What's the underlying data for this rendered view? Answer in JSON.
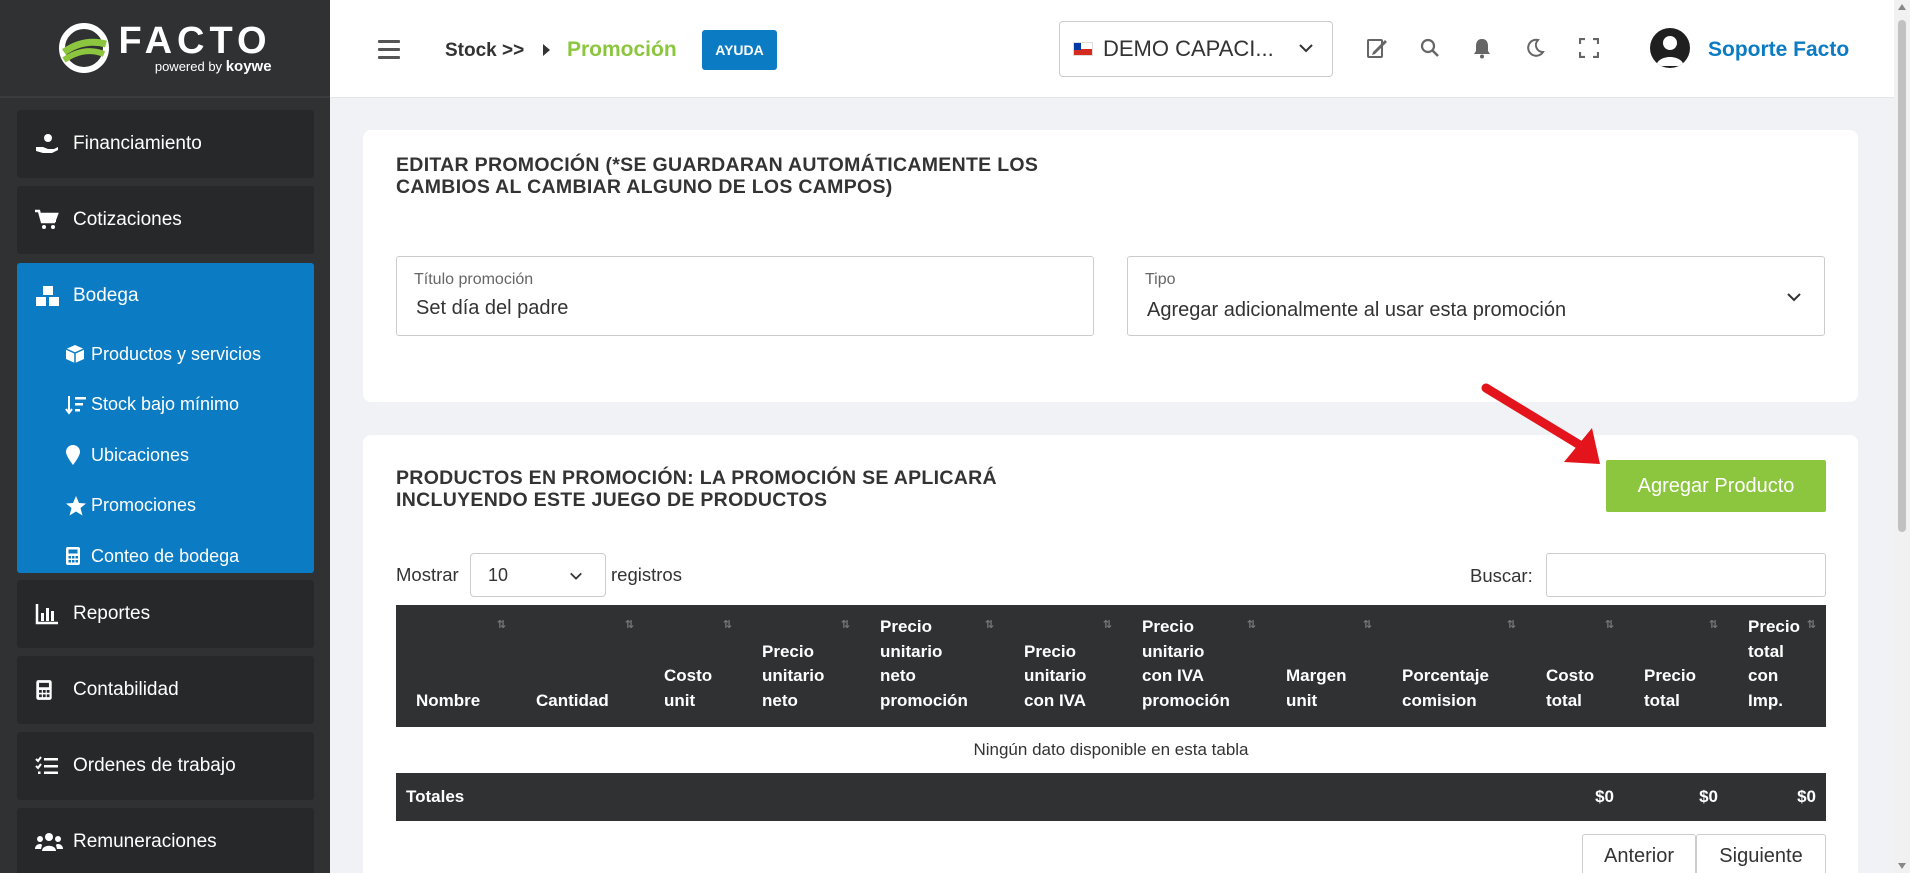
{
  "brand": {
    "name": "FACTO",
    "powered": "powered by",
    "partner": "koywe"
  },
  "sidebar": {
    "items_top": [
      {
        "label": "Financiamiento",
        "icon": "hand-money-icon"
      },
      {
        "label": "Cotizaciones",
        "icon": "cart-icon"
      }
    ],
    "group": {
      "label": "Bodega",
      "icon": "boxes-icon",
      "items": [
        {
          "label": "Productos y servicios",
          "icon": "box-icon"
        },
        {
          "label": "Stock bajo mínimo",
          "icon": "sort-down-icon"
        },
        {
          "label": "Ubicaciones",
          "icon": "map-pin-icon"
        },
        {
          "label": "Promociones",
          "icon": "star-icon"
        },
        {
          "label": "Conteo de bodega",
          "icon": "calculator-icon"
        }
      ]
    },
    "items_bottom": [
      {
        "label": "Reportes",
        "icon": "chart-icon"
      },
      {
        "label": "Contabilidad",
        "icon": "calculator-icon"
      },
      {
        "label": "Ordenes de trabajo",
        "icon": "task-list-icon"
      },
      {
        "label": "Remuneraciones",
        "icon": "users-icon"
      }
    ]
  },
  "header": {
    "breadcrumb_parent": "Stock >>",
    "breadcrumb_current": "Promoción",
    "help_label": "AYUDA",
    "company": "DEMO CAPACI...",
    "user_name": "Soporte Facto"
  },
  "edit_card": {
    "title": "EDITAR PROMOCIÓN (*SE GUARDARAN AUTOMÁTICAMENTE LOS CAMBIOS AL CAMBIAR ALGUNO DE LOS CAMPOS)",
    "title_line1": "EDITAR PROMOCIÓN (*SE GUARDARAN AUTOMÁTICAMENTE LOS",
    "title_line2": "CAMBIOS AL CAMBIAR ALGUNO DE LOS CAMPOS)",
    "title_field": {
      "label": "Título promoción",
      "value": "Set día del padre"
    },
    "type_field": {
      "label": "Tipo",
      "value": "Agregar adicionalmente al usar esta promoción"
    }
  },
  "products_card": {
    "title_line1": "PRODUCTOS EN PROMOCIÓN: LA PROMOCIÓN SE APLICARÁ",
    "title_line2": "INCLUYENDO ESTE JUEGO DE PRODUCTOS",
    "add_button": "Agregar Producto",
    "show_label": "Mostrar",
    "page_length": "10",
    "records_label": "registros",
    "search_label": "Buscar:",
    "search_value": "",
    "columns": [
      [
        "Nombre"
      ],
      [
        "Cantidad"
      ],
      [
        "Costo",
        "unit"
      ],
      [
        "Precio",
        "unitario",
        "neto"
      ],
      [
        "Precio",
        "unitario",
        "neto",
        "promoción"
      ],
      [
        "Precio",
        "unitario",
        "con IVA"
      ],
      [
        "Precio",
        "unitario",
        "con IVA",
        "promoción"
      ],
      [
        "Margen",
        "unit"
      ],
      [
        "Porcentaje",
        "comision"
      ],
      [
        "Costo",
        "total"
      ],
      [
        "Precio",
        "total"
      ],
      [
        "Precio",
        "total",
        "con",
        "Imp."
      ]
    ],
    "empty_message": "Ningún dato disponible en esta tabla",
    "totals_label": "Totales",
    "totals": {
      "costo_total": "$0",
      "precio_total": "$0",
      "precio_total_imp": "$0"
    },
    "prev_label": "Anterior",
    "next_label": "Siguiente"
  },
  "colors": {
    "sidebar_bg": "#2f3132",
    "active_blue": "#0b7bc4",
    "accent_green": "#8cc63f",
    "annotation_red": "#e3141b"
  }
}
